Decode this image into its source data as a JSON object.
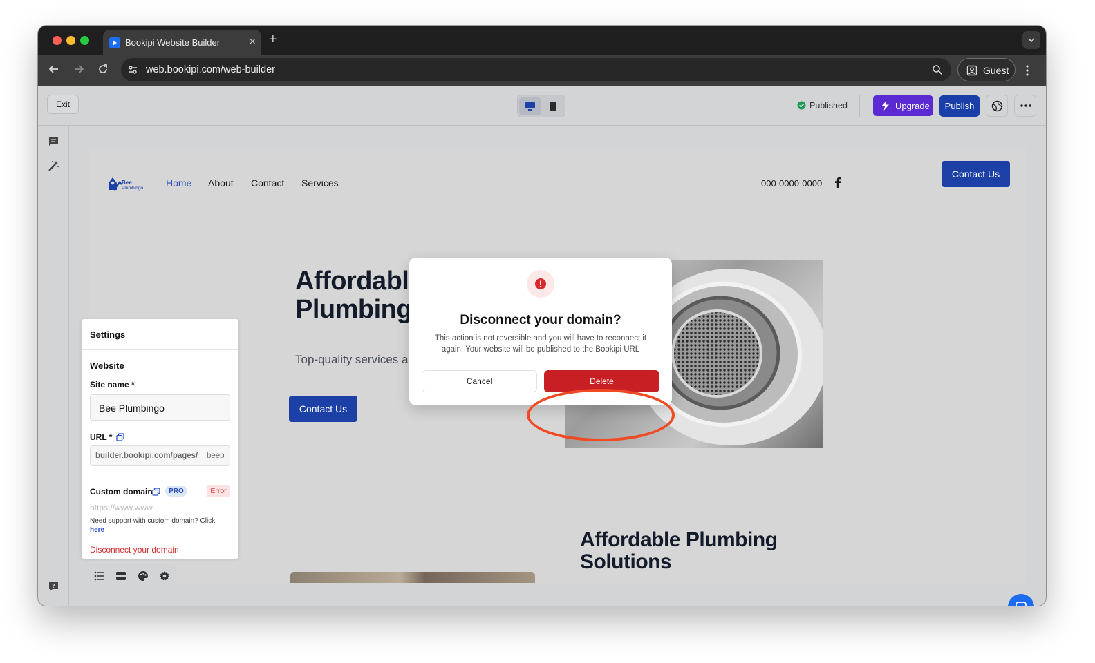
{
  "browser": {
    "tab_title": "Bookipi Website Builder",
    "tab_close": "×",
    "new_tab": "+",
    "url": "web.bookipi.com/web-builder",
    "profile_label": "Guest"
  },
  "topbar": {
    "exit_label": "Exit",
    "status_label": "Published",
    "upgrade_label": "Upgrade",
    "publish_label": "Publish"
  },
  "site": {
    "logo_text_top": "Bee",
    "logo_text_bottom": "Plumbingo",
    "nav": [
      {
        "label": "Home",
        "active": true
      },
      {
        "label": "About"
      },
      {
        "label": "Contact"
      },
      {
        "label": "Services"
      }
    ],
    "phone": "000-0000-0000",
    "contact_label": "Contact Us",
    "hero_title_line1": "Affordable",
    "hero_title_line2": "Plumbing",
    "hero_subtitle": "Top-quality services a",
    "hero_button": "Contact Us",
    "section2_title_line1": "Affordable Plumbing",
    "section2_title_line2": "Solutions"
  },
  "settings": {
    "title": "Settings",
    "section": "Website",
    "site_name_label": "Site name *",
    "site_name_value": "Bee Plumbingo",
    "url_label": "URL *",
    "url_prefix": "builder.bookipi.com/pages/",
    "url_slug": "beep",
    "custom_domain_label": "Custom domain",
    "pro_badge": "PRO",
    "error_badge": "Error",
    "domain_placeholder": "https://www.www.",
    "help_text": "Need support with custom domain? Click",
    "help_link": "here",
    "disconnect_label": "Disconnect your domain"
  },
  "modal": {
    "title": "Disconnect your domain?",
    "description": "This action is not reversible and you will have to reconnect it again. Your website will be published to the Bookipi URL",
    "cancel_label": "Cancel",
    "delete_label": "Delete"
  },
  "colors": {
    "accent_primary": "#1d40a6",
    "upgrade": "#5b2ad2",
    "danger": "#c81f25",
    "annotation": "#ef4a23"
  }
}
